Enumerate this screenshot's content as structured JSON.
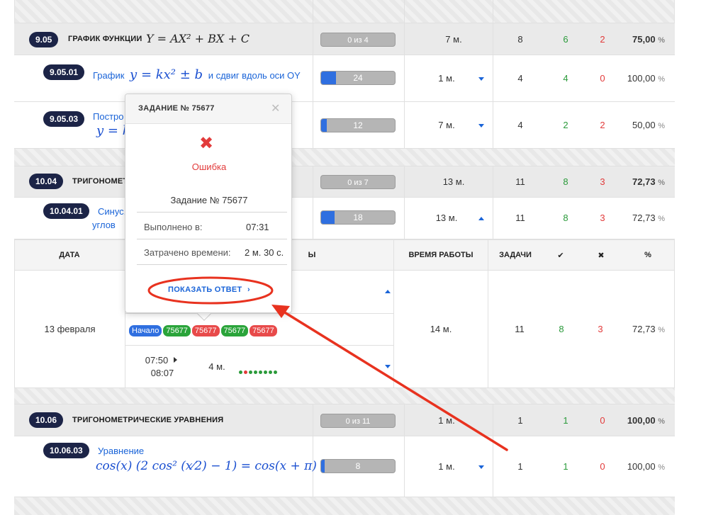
{
  "colors": {
    "accent": "#1a64d8",
    "badge": "#1c2447",
    "success": "#2a9a3a",
    "error": "#e23b3b",
    "annotation": "#e8321f"
  },
  "section_905": {
    "badge": "9.05",
    "title": "ГРАФИК ФУНКЦИИ",
    "formula": "Y = AX² + BX + C",
    "progress": "0 из 4",
    "progress_value": 0,
    "time": "7 м.",
    "tasks": "8",
    "correct": "6",
    "wrong": "2",
    "percent": "75,00",
    "percent_unit": "%"
  },
  "row_90501": {
    "badge": "9.05.01",
    "link_prefix": "График",
    "formula": "y = kx² ± b",
    "link_suffix": "и сдвиг вдоль оси OY",
    "progress": "24",
    "progress_value": 0.2,
    "time": "1 м.",
    "tasks": "4",
    "correct": "4",
    "wrong": "0",
    "percent": "100,00",
    "percent_unit": "%"
  },
  "row_90503": {
    "badge": "9.05.03",
    "link_prefix": "Постро",
    "formula": "y = k",
    "progress": "12",
    "progress_value": 0.08,
    "time": "7 м.",
    "tasks": "4",
    "correct": "2",
    "wrong": "2",
    "percent": "50,00",
    "percent_unit": "%"
  },
  "section_1004": {
    "badge": "10.04",
    "title": "ТРИГОНОМЕТ",
    "progress": "0 из 7",
    "progress_value": 0,
    "time": "13 м.",
    "tasks": "11",
    "correct": "8",
    "wrong": "3",
    "percent": "72,73",
    "percent_unit": "%"
  },
  "row_100401": {
    "badge": "10.04.01",
    "link_line1": "Синус,",
    "link_line2": "углов",
    "progress": "18",
    "progress_value": 0.18,
    "time": "13 м.",
    "tasks": "11",
    "correct": "8",
    "wrong": "3",
    "percent": "72,73",
    "percent_unit": "%"
  },
  "history": {
    "headers": {
      "date": "ДАТА",
      "tasks_suffix": "Ы",
      "work_time": "ВРЕМЯ РАБОТЫ",
      "tasks": "ЗАДАЧИ",
      "check": "✔",
      "cross": "✖",
      "percent": "%"
    },
    "date": "13 февраля",
    "chips": [
      {
        "label": "Начало",
        "kind": "start"
      },
      {
        "label": "75677",
        "kind": "ok"
      },
      {
        "label": "75677",
        "kind": "err"
      },
      {
        "label": "75677",
        "kind": "ok"
      },
      {
        "label": "75677",
        "kind": "err"
      }
    ],
    "session_start": "07:50",
    "session_end": "08:07",
    "session_duration": "4 м.",
    "dot_colors": [
      "#2a9a3a",
      "#e23b3b",
      "#2a9a3a",
      "#2a9a3a",
      "#2a9a3a",
      "#2a9a3a",
      "#2a9a3a",
      "#2a9a3a"
    ],
    "work_time": "14 м.",
    "tasks": "11",
    "correct": "8",
    "wrong": "3",
    "percent": "72,73",
    "percent_unit": "%"
  },
  "section_1006": {
    "badge": "10.06",
    "title": "ТРИГОНОМЕТРИЧЕСКИЕ УРАВНЕНИЯ",
    "progress": "0 из 11",
    "progress_value": 0,
    "time": "1 м.",
    "tasks": "1",
    "correct": "1",
    "wrong": "0",
    "percent": "100,00",
    "percent_unit": "%"
  },
  "row_100603": {
    "badge": "10.06.03",
    "link": "Уравнение",
    "formula": "cos(x) (2 cos² (x⁄2) − 1) = cos(x + π)",
    "progress": "8",
    "progress_value": 0.05,
    "time": "1 м.",
    "tasks": "1",
    "correct": "1",
    "wrong": "0",
    "percent": "100,00",
    "percent_unit": "%"
  },
  "popup": {
    "title": "ЗАДАНИЕ № 75677",
    "close_icon": "close-icon",
    "status_icon": "cross-icon",
    "status": "Ошибка",
    "task_label": "Задание № 75677",
    "done_label": "Выполнено в:",
    "done_value": "07:31",
    "spent_label": "Затрачено времени:",
    "spent_value": "2 м. 30 с.",
    "show_answer": "ПОКАЗАТЬ ОТВЕТ"
  }
}
